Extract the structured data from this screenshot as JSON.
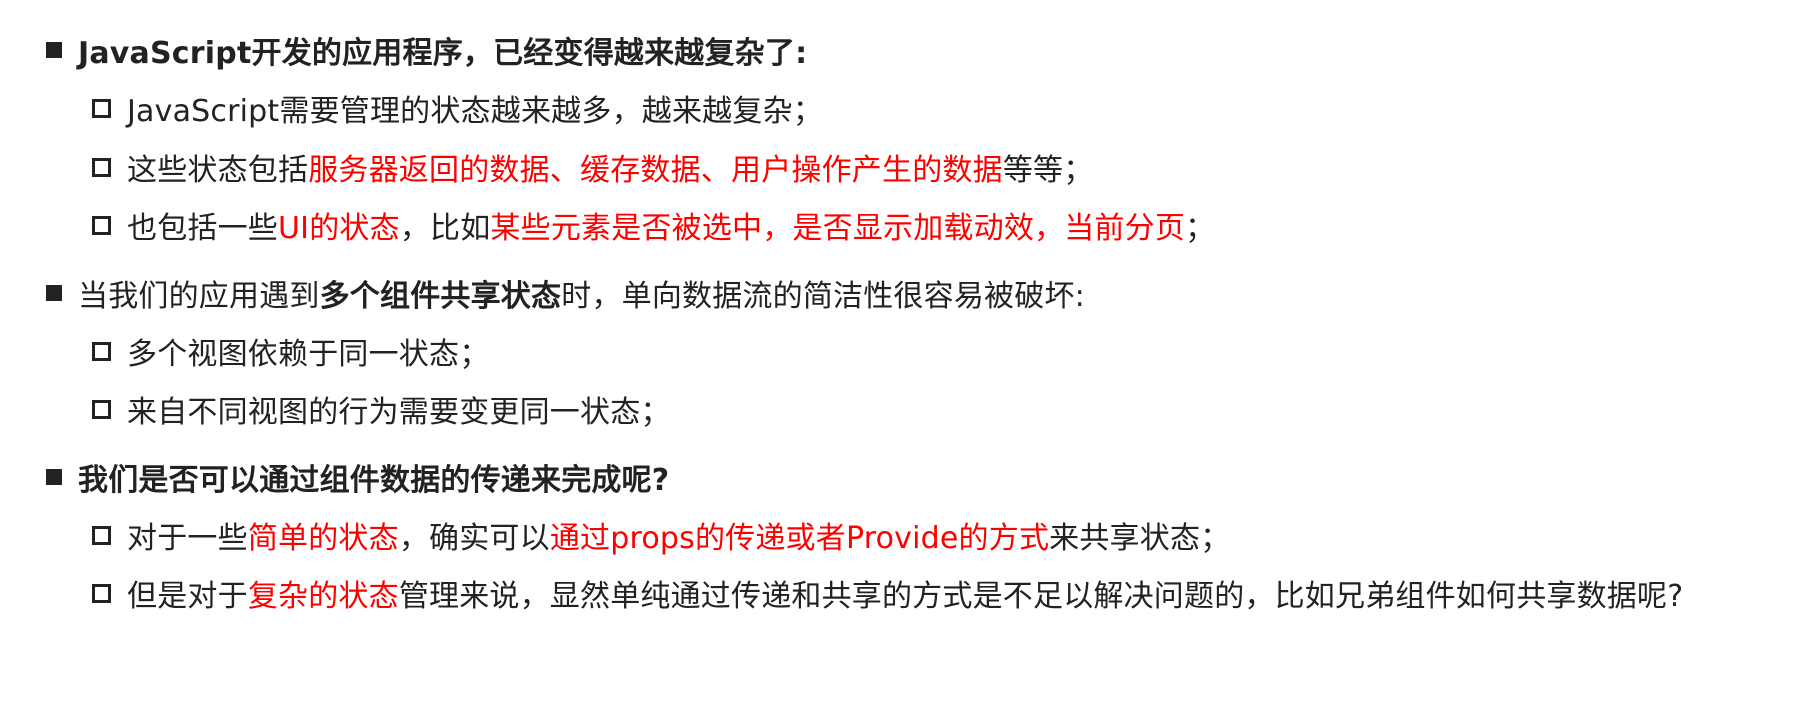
{
  "colors": {
    "text": "#222222",
    "highlight": "#ff0000"
  },
  "s1": {
    "title": "JavaScript开发的应用程序，已经变得越来越复杂了:",
    "b1": "JavaScript需要管理的状态越来越多，越来越复杂；",
    "b2": {
      "a": "这些状态包括",
      "b": "服务器返回的数据、缓存数据、用户操作产生的数据",
      "c": "等等；"
    },
    "b3": {
      "a": "也包括一些",
      "b": "UI的状态",
      "c": "，比如",
      "d": "某些元素是否被选中，是否显示加载动效，当前分页",
      "e": "；"
    }
  },
  "s2": {
    "title": {
      "a": "当我们的应用遇到",
      "b": "多个组件共享状态",
      "c": "时，单向数据流的简洁性很容易被破坏:"
    },
    "b1": "多个视图依赖于同一状态；",
    "b2": "来自不同视图的行为需要变更同一状态；"
  },
  "s3": {
    "title": "我们是否可以通过组件数据的传递来完成呢?",
    "b1": {
      "a": "对于一些",
      "b": "简单的状态",
      "c": "，确实可以",
      "d": "通过props的传递或者Provide的方式",
      "e": "来共享状态；"
    },
    "b2": {
      "a": "但是对于",
      "b": "复杂的状态",
      "c": "管理来说，显然单纯通过传递和共享的方式是不足以解决问题的，比如兄弟组件如何共享数据呢?"
    }
  }
}
